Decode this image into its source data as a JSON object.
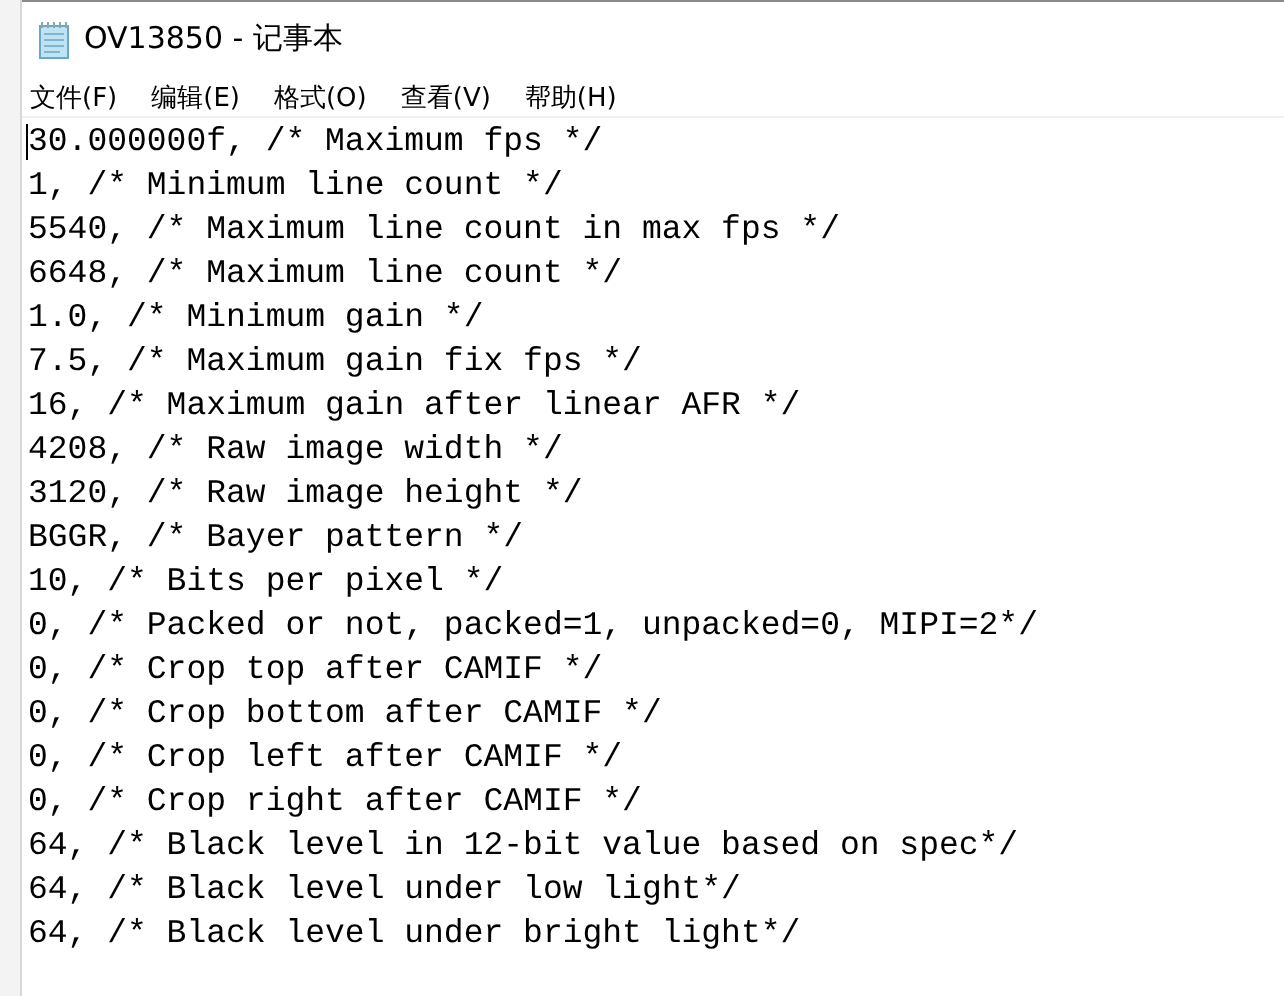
{
  "window": {
    "title": "OV13850 - 记事本"
  },
  "menu": [
    {
      "label": "文件(F)"
    },
    {
      "label": "编辑(E)"
    },
    {
      "label": "格式(O)"
    },
    {
      "label": "查看(V)"
    },
    {
      "label": "帮助(H)"
    }
  ],
  "editor": {
    "lines": [
      "30.000000f, /* Maximum fps */",
      "1, /* Minimum line count */",
      "5540, /* Maximum line count in max fps */",
      "6648, /* Maximum line count */",
      "1.0, /* Minimum gain */",
      "7.5, /* Maximum gain fix fps */",
      "16, /* Maximum gain after linear AFR */",
      "4208, /* Raw image width */",
      "3120, /* Raw image height */",
      "BGGR, /* Bayer pattern */",
      "10, /* Bits per pixel */",
      "0, /* Packed or not, packed=1, unpacked=0, MIPI=2*/",
      "0, /* Crop top after CAMIF */",
      "0, /* Crop bottom after CAMIF */",
      "0, /* Crop left after CAMIF */",
      "0, /* Crop right after CAMIF */",
      "64, /* Black level in 12-bit value based on spec*/",
      "64, /* Black level under low light*/",
      "64, /* Black level under bright light*/"
    ]
  }
}
